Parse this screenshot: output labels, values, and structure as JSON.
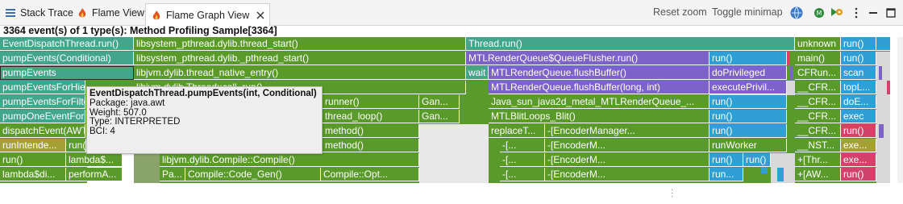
{
  "tabs": [
    {
      "label": "Stack Trace",
      "icon": "list-icon"
    },
    {
      "label": "Flame View",
      "icon": "flame-icon"
    },
    {
      "label": "Flame Graph View",
      "icon": "flame-icon"
    }
  ],
  "toolbar": {
    "reset_zoom": "Reset zoom",
    "toggle_minimap": "Toggle minimap"
  },
  "header": "3364 event(s) of 1 type(s): Method Profiling Sample[3364]",
  "colors": {
    "green": "#5a9a2a",
    "teal": "#43a58b",
    "purple": "#7c62c9",
    "blue": "#2f9fd6",
    "red": "#d2426b",
    "olive": "#a5a033",
    "tooltip_bg": "#eeeeee"
  },
  "flame": {
    "rows": [
      [
        {
          "label": "EventDispatchThread.run()",
          "color": "teal"
        },
        {
          "label": "libsystem_pthread.dylib.thread_start()",
          "color": "green"
        },
        {
          "label": "Thread.run()",
          "color": "teal"
        },
        {
          "label": "unknown",
          "color": "green"
        },
        {
          "label": "run()",
          "color": "blue"
        },
        {
          "label": "",
          "color": "blue"
        }
      ],
      [
        {
          "label": "pumpEvents(Conditional)",
          "color": "teal"
        },
        {
          "label": "libsystem_pthread.dylib._pthread_start()",
          "color": "green"
        },
        {
          "label": "MTLRenderQueue$QueueFlusher.run()",
          "color": "purple"
        },
        {
          "label": "run()",
          "color": "blue"
        },
        {
          "label": "main()",
          "color": "green"
        },
        {
          "label": "run()",
          "color": "blue"
        }
      ],
      [
        {
          "label": "pumpEvents",
          "color": "teal"
        },
        {
          "label": "libjvm.dylib.thread_native_entry()",
          "color": "green"
        },
        {
          "label": "wait",
          "color": "teal"
        },
        {
          "label": "MTLRenderQueue.flushBuffer()",
          "color": "purple"
        },
        {
          "label": "doPrivileged",
          "color": "purple"
        },
        {
          "label": "CFRun...",
          "color": "green"
        },
        {
          "label": "scan",
          "color": "blue"
        }
      ],
      [
        {
          "label": "pumpEventsForHierarchy",
          "color": "teal"
        },
        {
          "label": "libjvm.dylib.Thread::call_run()",
          "color": "green"
        },
        {
          "label": "MTLRenderQueue.flushBuffer(long, int)",
          "color": "purple"
        },
        {
          "label": "executePrivil...",
          "color": "purple"
        },
        {
          "label": "__CFR...",
          "color": "green"
        },
        {
          "label": "topL...",
          "color": "blue"
        }
      ],
      [
        {
          "label": "pumpEventsForFilter",
          "color": "teal"
        },
        {
          "label": "runner()",
          "color": "green"
        },
        {
          "label": "Gan...",
          "color": "green"
        },
        {
          "label": "Java_sun_java2d_metal_MTLRenderQueue_...",
          "color": "green"
        },
        {
          "label": "run()",
          "color": "blue"
        },
        {
          "label": "__CFR...",
          "color": "green"
        },
        {
          "label": "doE...",
          "color": "blue"
        }
      ],
      [
        {
          "label": "pumpOneEventForFilters",
          "color": "teal"
        },
        {
          "label": "thread_loop()",
          "color": "green"
        },
        {
          "label": "Gan...",
          "color": "green"
        },
        {
          "label": "MTLBlitLoops_Blit()",
          "color": "green"
        },
        {
          "label": "run()",
          "color": "blue"
        },
        {
          "label": "__CFR...",
          "color": "green"
        },
        {
          "label": "exec",
          "color": "blue"
        }
      ],
      [
        {
          "label": "dispatchEvent(AWTEvent)",
          "color": "green"
        },
        {
          "label": "method()",
          "color": "green"
        },
        {
          "label": "replaceT...",
          "color": "green"
        },
        {
          "label": "-[EncoderManager...",
          "color": "green"
        },
        {
          "label": "run()",
          "color": "blue"
        },
        {
          "label": "__CFR...",
          "color": "green"
        },
        {
          "label": "run()",
          "color": "red"
        }
      ],
      [
        {
          "label": "runIntende...",
          "color": "olive"
        },
        {
          "label": "run()",
          "color": "green"
        },
        {
          "label": "method()",
          "color": "green"
        },
        {
          "label": "-[...",
          "color": "green"
        },
        {
          "label": "-[EncoderM...",
          "color": "green"
        },
        {
          "label": "runWorker",
          "color": "green"
        },
        {
          "label": "__NST...",
          "color": "green"
        },
        {
          "label": "exe...",
          "color": "olive"
        }
      ],
      [
        {
          "label": "run()",
          "color": "green"
        },
        {
          "label": "lambda$...",
          "color": "green"
        },
        {
          "label": "libjvm.dylib.Compile::Compile()",
          "color": "green"
        },
        {
          "label": "-[...",
          "color": "green"
        },
        {
          "label": "-[EncoderM...",
          "color": "green"
        },
        {
          "label": "run()",
          "color": "blue"
        },
        {
          "label": "run()",
          "color": "blue"
        },
        {
          "label": "+[Thr...",
          "color": "green"
        },
        {
          "label": "exe...",
          "color": "red"
        }
      ],
      [
        {
          "label": "lambda$di...",
          "color": "green"
        },
        {
          "label": "performA...",
          "color": "green"
        },
        {
          "label": "Pa...",
          "color": "green"
        },
        {
          "label": "Compile::Code_Gen()",
          "color": "green"
        },
        {
          "label": "Compile::Opt...",
          "color": "green"
        },
        {
          "label": "-[...",
          "color": "green"
        },
        {
          "label": "-[EncoderM...",
          "color": "green"
        },
        {
          "label": "run...",
          "color": "blue"
        },
        {
          "label": "+[AW...",
          "color": "green"
        },
        {
          "label": "run()",
          "color": "red"
        }
      ]
    ]
  },
  "tooltip": {
    "title": "EventDispatchThread.pumpEvents(int, Conditional)",
    "package": "Package: java.awt",
    "weight": "Weight: 507.0",
    "type": "Type: INTERPRETED",
    "bci": "BCI: 4"
  }
}
